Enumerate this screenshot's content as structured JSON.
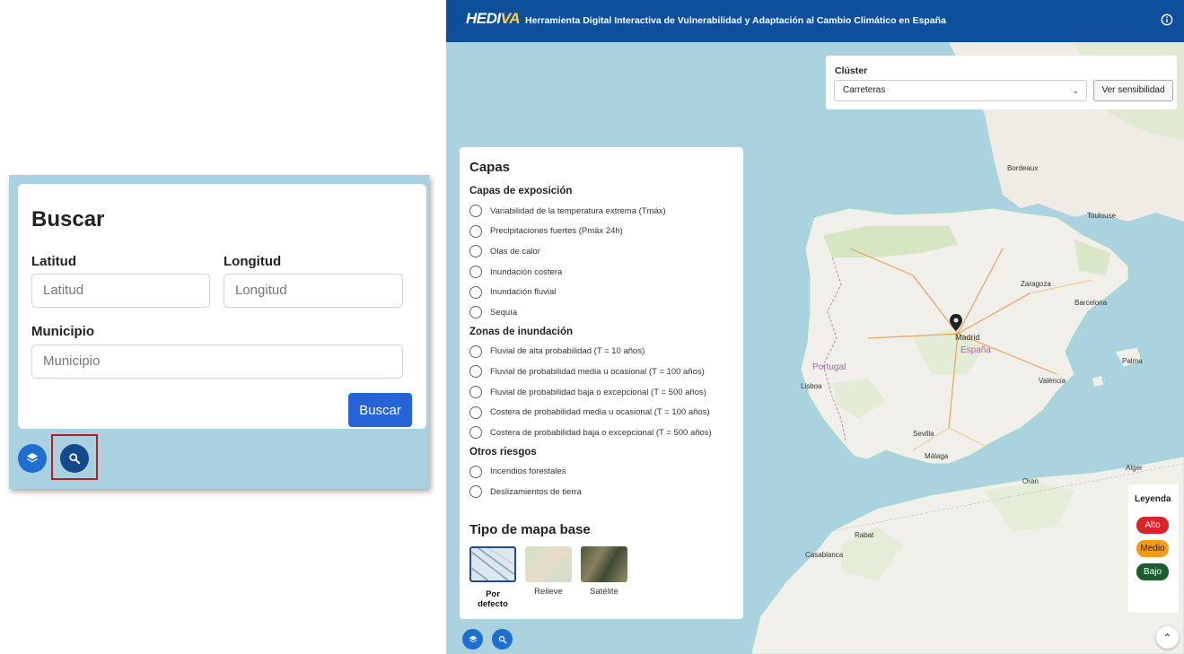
{
  "zoom_panel": {
    "title": "Buscar",
    "lat_label": "Latitud",
    "lat_placeholder": "Latitud",
    "lon_label": "Longitud",
    "lon_placeholder": "Longitud",
    "mun_label": "Municipio",
    "mun_placeholder": "Municipio",
    "search_button": "Buscar"
  },
  "header": {
    "logo_main": "HEDI",
    "logo_accent": "VA",
    "title": "Herramienta Digital Interactiva de Vulnerabilidad y Adaptación al Cambio Climático en España"
  },
  "cluster": {
    "label": "Clúster",
    "selected": "Carreteras",
    "button": "Ver sensibilidad"
  },
  "layers": {
    "title": "Capas",
    "exposure_title": "Capas de exposición",
    "exposure": [
      "Variabilidad de la temperatura extrema (Tmáx)",
      "Precipitaciones fuertes (Pmáx 24h)",
      "Olas de calor",
      "Inundación costera",
      "Inundación fluvial",
      "Sequía"
    ],
    "flood_title": "Zonas de inundación",
    "flood": [
      "Fluvial de alta probabilidad (T = 10 años)",
      "Fluvial de probabilidad media u ocasional (T = 100 años)",
      "Fluvial de probabilidad baja o excepcional (T = 500 años)",
      "Costera de probabilidad media u ocasional (T = 100 años)",
      "Costera de probabilidad baja o excepcional (T = 500 años)"
    ],
    "other_title": "Otros riesgos",
    "other": [
      "Incendios forestales",
      "Deslizamientos de tierra"
    ],
    "base_title": "Tipo de mapa base",
    "base_maps": [
      "Por defecto",
      "Relieve",
      "Satélite"
    ]
  },
  "legend": {
    "title": "Leyenda",
    "items": [
      "Alto",
      "Medio",
      "Bajo"
    ],
    "colors": [
      "#d9232a",
      "#f29a1c",
      "#1d5c2e"
    ]
  },
  "map_labels": {
    "madrid": "Madrid",
    "espana": "España",
    "portugal": "Portugal",
    "lisboa": "Lisboa",
    "barcelona": "Barcelona",
    "valencia": "València",
    "sevilla": "Sevilla",
    "zaragoza": "Zaragoza",
    "bordeaux": "Bordeaux",
    "toulouse": "Toulouse",
    "malaga": "Málaga",
    "palma": "Palma",
    "oran": "Oran",
    "alger": "Alger",
    "rabat": "Rabat",
    "casablanca": "Casablanca"
  },
  "colors": {
    "header": "#0e4f9b",
    "accent": "#2563d6",
    "water": "#aad3df",
    "land": "#f1efe9"
  }
}
